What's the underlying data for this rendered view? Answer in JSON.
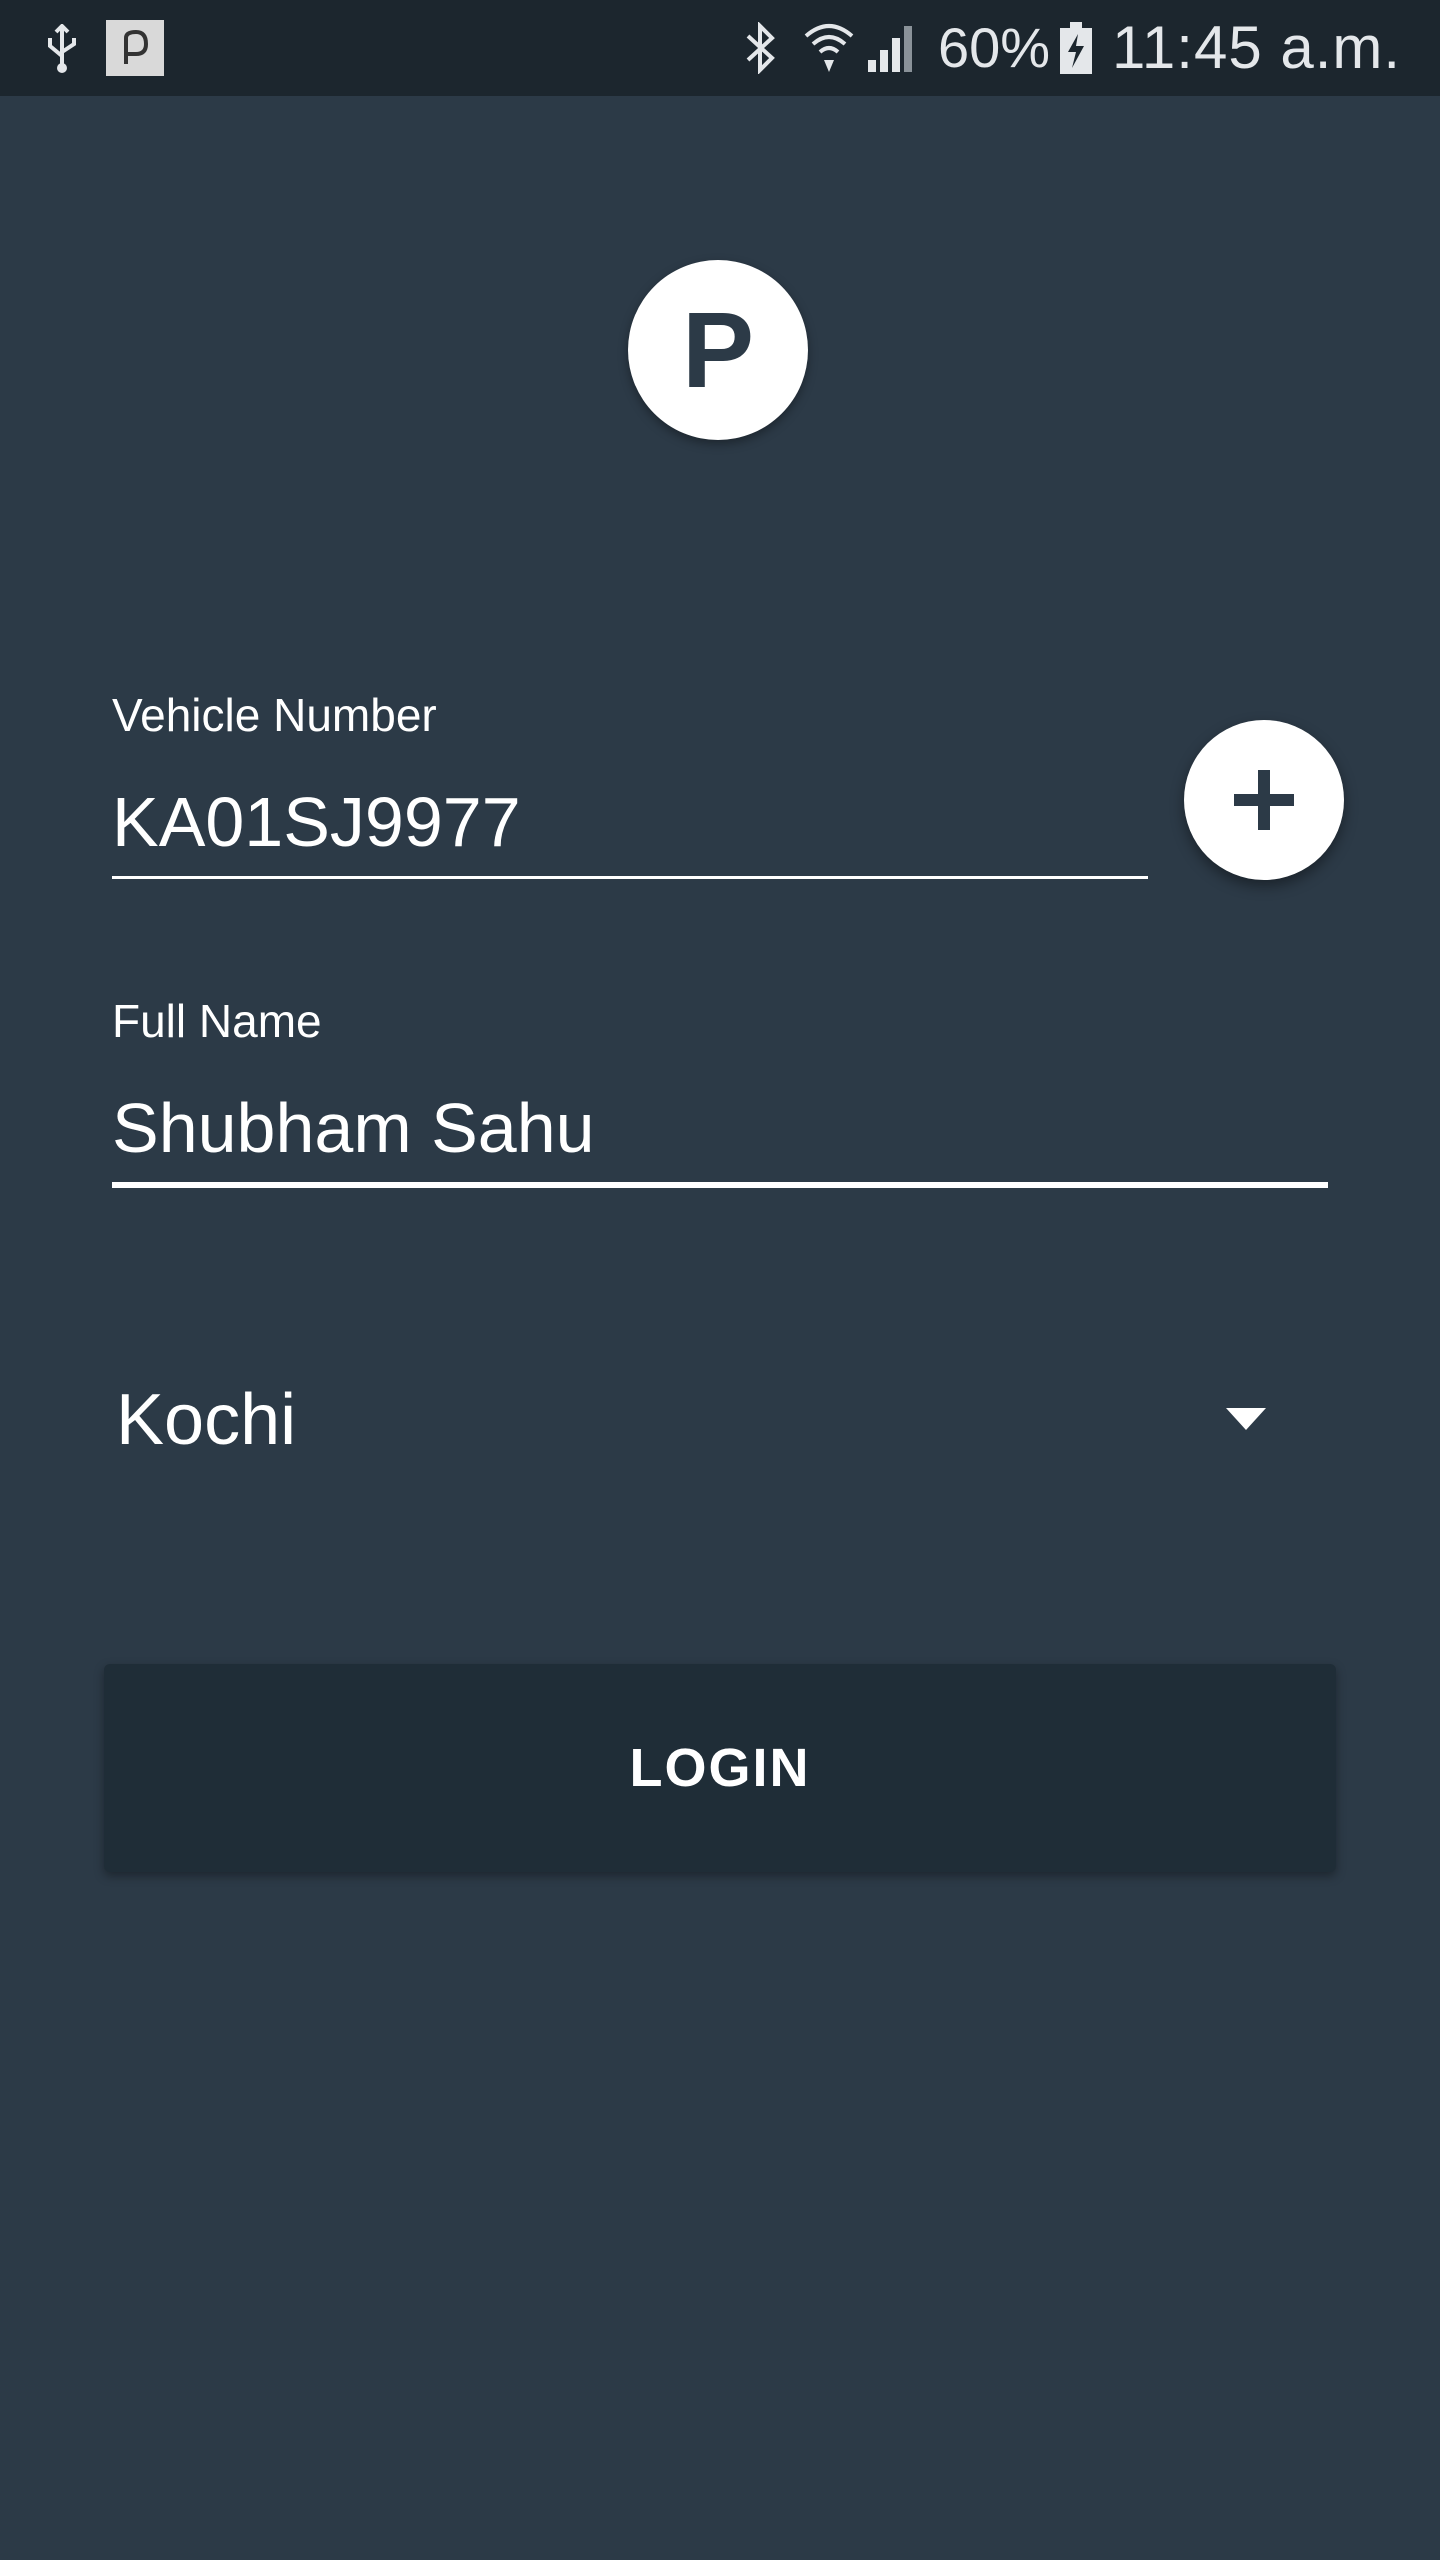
{
  "status_bar": {
    "battery_percent": "60%",
    "time": "11:45 a.m.",
    "icons": [
      "usb-icon",
      "app-notification-icon",
      "bluetooth-icon",
      "wifi-icon",
      "signal-icon",
      "battery-charging-icon"
    ]
  },
  "logo": {
    "letter": "P"
  },
  "form": {
    "vehicle_number": {
      "label": "Vehicle Number",
      "value": "KA01SJ9977"
    },
    "full_name": {
      "label": "Full Name",
      "value": "Shubham Sahu"
    },
    "add_button_icon": "plus-icon",
    "city": {
      "selected": "Kochi"
    },
    "login_label": "LOGIN"
  },
  "colors": {
    "background": "#2c3a47",
    "status_bar": "#1c262e",
    "button": "#1f2d37",
    "foreground": "#ffffff"
  }
}
